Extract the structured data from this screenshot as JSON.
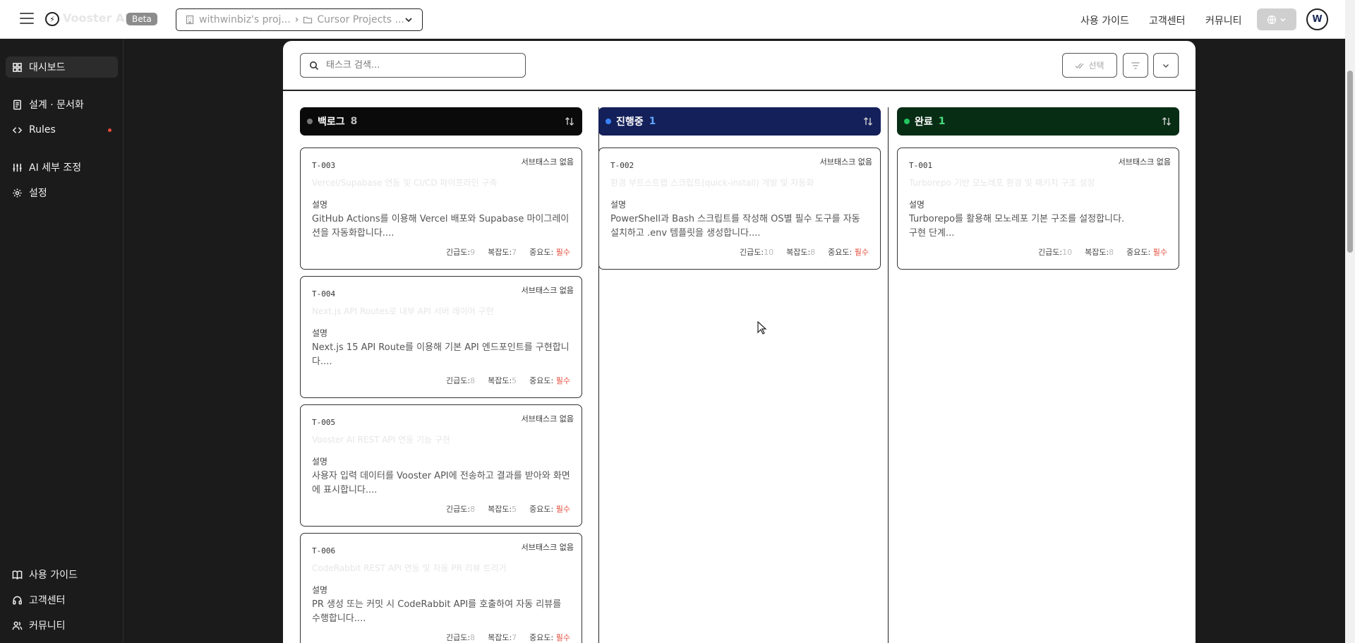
{
  "topbar": {
    "brand": "Vooster AI",
    "beta": "Beta",
    "project": "withwinbiz's proj...",
    "folder": "Cursor Projects ...",
    "nav": [
      "사용 가이드",
      "고객센터",
      "커뮤니티"
    ],
    "avatar": "W"
  },
  "sidebar": {
    "items": [
      {
        "label": "대시보드",
        "icon": "dashboard-icon"
      },
      {
        "label": "설계 · 문서화",
        "icon": "document-icon"
      },
      {
        "label": "Rules",
        "icon": "code-icon"
      },
      {
        "label": "AI 세부 조정",
        "icon": "sliders-icon"
      },
      {
        "label": "설정",
        "icon": "gear-icon"
      }
    ],
    "bottom": [
      {
        "label": "사용 가이드",
        "icon": "book-icon"
      },
      {
        "label": "고객센터",
        "icon": "headset-icon"
      },
      {
        "label": "커뮤니티",
        "icon": "users-icon"
      }
    ]
  },
  "search": {
    "placeholder": "태스크 검색..."
  },
  "toolbar": {
    "select_label": "선택"
  },
  "columns": [
    {
      "title": "백로그",
      "count": "8",
      "bg": "#0a0a0a",
      "dot": "#777777",
      "count_color": "#bbbbbb"
    },
    {
      "title": "진행중",
      "count": "1",
      "bg": "#14205a",
      "dot": "#3b82f6",
      "count_color": "#60a5fa"
    },
    {
      "title": "완료",
      "count": "1",
      "bg": "#072d15",
      "dot": "#22c55e",
      "count_color": "#4ade80"
    }
  ],
  "labels": {
    "subtask": "서브태스크 없음",
    "desc": "설명",
    "urgency": "긴급도:",
    "complexity": "복잡도:",
    "importance": "중요도:",
    "required": "필수"
  },
  "cards": {
    "backlog": [
      {
        "id": "T-003",
        "title": "Vercel/Supabase 연동 및 CI/CD 파이프라인 구축",
        "desc": "GitHub Actions를 이용해 Vercel 배포와 Supabase 마이그레이션을 자동화합니다....",
        "urgency": "9",
        "complexity": "7"
      },
      {
        "id": "T-004",
        "title": "Next.js API Routes로 내부 API 서버 레이어 구현",
        "desc": "Next.js 15 API Route를 이용해 기본 API 엔드포인트를 구현합니다....",
        "urgency": "8",
        "complexity": "5"
      },
      {
        "id": "T-005",
        "title": "Vooster AI REST API 연동 기능 구현",
        "desc": "사용자 입력 데이터를 Vooster API에 전송하고 결과를 받아와 화면에 표시합니다....",
        "urgency": "8",
        "complexity": "5"
      },
      {
        "id": "T-006",
        "title": "CodeRabbit REST API 연동 및 자동 PR 리뷰 트리거",
        "desc": "PR 생성 또는 커밋 시 CodeRabbit API를 호출하여 자동 리뷰를 수행합니다....",
        "urgency": "8",
        "complexity": "7"
      }
    ],
    "progress": [
      {
        "id": "T-002",
        "title": "환경 부트스트랩 스크립트(quick-install) 개발 및 자동화",
        "desc": "PowerShell과 Bash 스크립트를 작성해 OS별 필수 도구를 자동 설치하고 .env 템플릿을 생성합니다....",
        "urgency": "10",
        "complexity": "8"
      }
    ],
    "done": [
      {
        "id": "T-001",
        "title": "Turborepo 기반 모노레포 환경 및 패키지 구조 설정",
        "desc": "Turborepo를 활용해 모노레포 기본 구조를 설정합니다.\n구현 단계...",
        "urgency": "10",
        "complexity": "8"
      }
    ]
  }
}
